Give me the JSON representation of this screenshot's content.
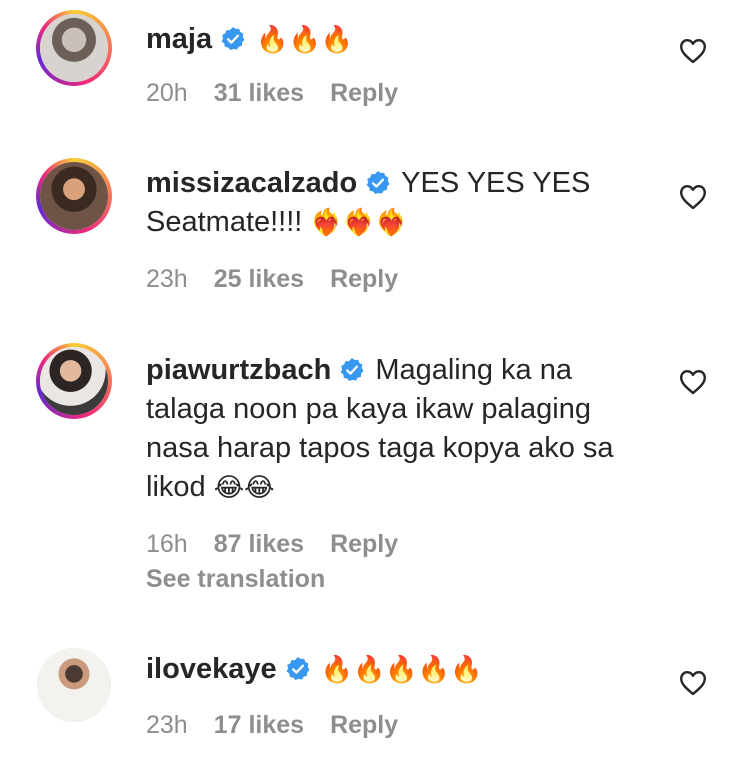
{
  "colors": {
    "text": "#262626",
    "muted": "#8e8e8e",
    "verified": "#3897f0"
  },
  "comments": [
    {
      "username": "maja",
      "text": "",
      "emoji": "🔥🔥🔥",
      "time": "20h",
      "likes": "31 likes",
      "reply": "Reply",
      "avatar_ring": true
    },
    {
      "username": "missizacalzado",
      "text": "YES YES YES Seatmate!!!!",
      "emoji": "❤️‍🔥❤️‍🔥❤️‍🔥",
      "time": "23h",
      "likes": "25 likes",
      "reply": "Reply",
      "avatar_ring": true
    },
    {
      "username": "piawurtzbach",
      "text": "Magaling ka na talaga noon pa kaya ikaw palaging nasa harap tapos taga kopya ako sa likod",
      "emoji": "😂😂",
      "time": "16h",
      "likes": "87 likes",
      "reply": "Reply",
      "see_translation": "See translation",
      "avatar_ring": true
    },
    {
      "username": "ilovekaye",
      "text": "",
      "emoji": "🔥🔥🔥🔥🔥",
      "time": "23h",
      "likes": "17 likes",
      "reply": "Reply",
      "avatar_ring": false
    }
  ],
  "icons": {
    "verified": "verified-badge-icon",
    "like": "heart-outline-icon"
  }
}
